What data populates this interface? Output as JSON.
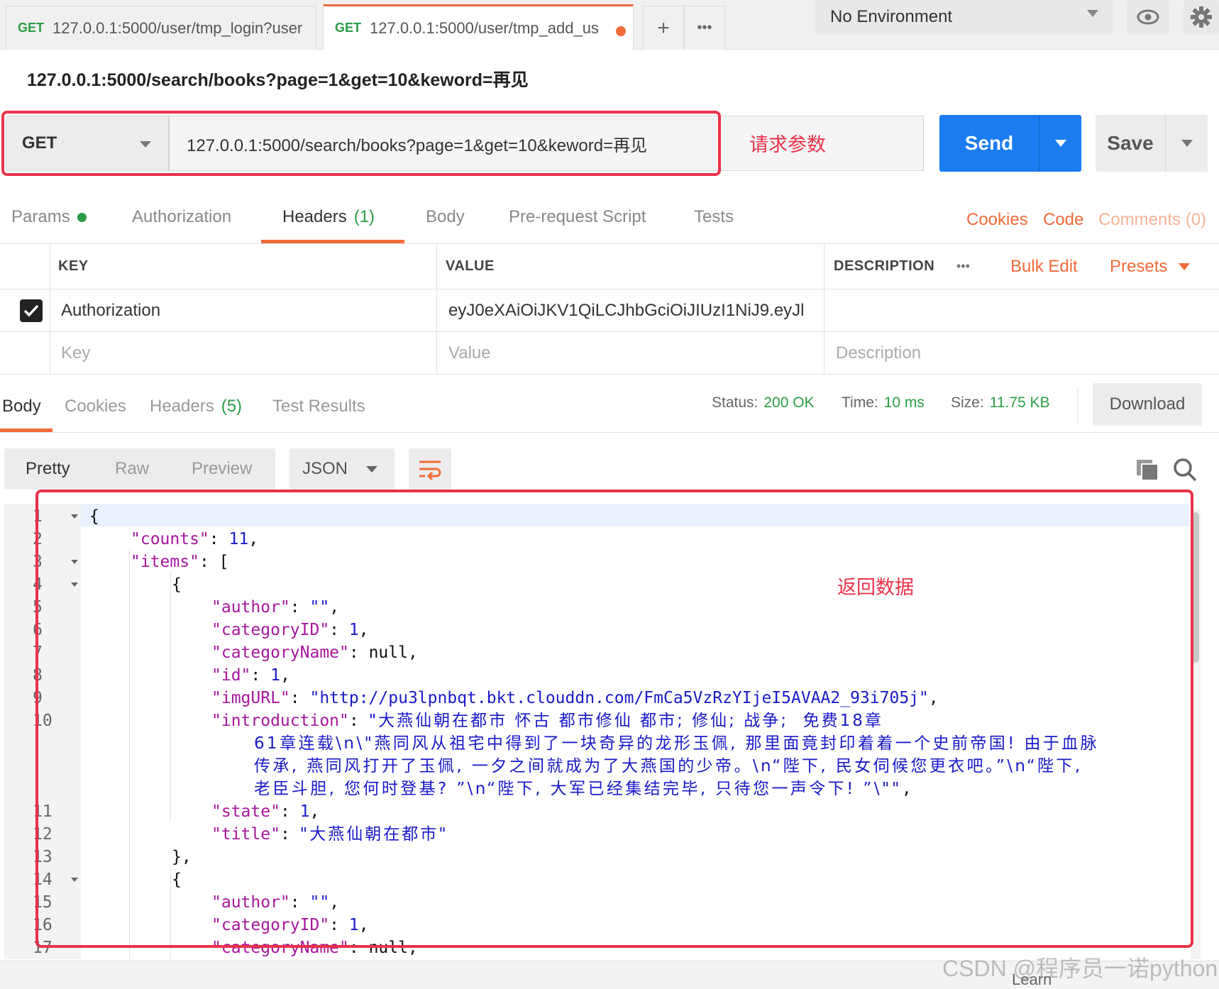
{
  "tabs": [
    {
      "method": "GET",
      "title": "127.0.0.1:5000/user/tmp_login?user"
    },
    {
      "method": "GET",
      "title": "127.0.0.1:5000/user/tmp_add_us"
    }
  ],
  "tab_controls": {
    "add": "+",
    "more": "•••"
  },
  "environment": {
    "selected": "No Environment"
  },
  "request": {
    "name": "127.0.0.1:5000/search/books?page=1&get=10&keword=再见",
    "method": "GET",
    "url": "127.0.0.1:5000/search/books?page=1&get=10&keword=再见",
    "send_label": "Send",
    "save_label": "Save"
  },
  "annotations": {
    "request_params": "请求参数",
    "response_data": "返回数据"
  },
  "request_tabs": {
    "params": "Params",
    "authorization": "Authorization",
    "headers": "Headers",
    "headers_count": "(1)",
    "body": "Body",
    "prerequest": "Pre-request Script",
    "tests": "Tests",
    "cookies": "Cookies",
    "code": "Code",
    "comments": "Comments (0)"
  },
  "headers_table": {
    "columns": {
      "key": "KEY",
      "value": "VALUE",
      "description": "DESCRIPTION"
    },
    "more": "•••",
    "bulk_edit": "Bulk Edit",
    "presets": "Presets",
    "rows": [
      {
        "enabled": true,
        "key": "Authorization",
        "value": "eyJ0eXAiOiJKV1QiLCJhbGciOiJIUzI1NiJ9.eyJle..."
      }
    ],
    "placeholder": {
      "key": "Key",
      "value": "Value",
      "description": "Description"
    }
  },
  "response": {
    "tabs": {
      "body": "Body",
      "cookies": "Cookies",
      "headers": "Headers",
      "headers_count": "(5)",
      "test_results": "Test Results"
    },
    "status_label": "Status:",
    "status": "200 OK",
    "time_label": "Time:",
    "time": "10 ms",
    "size_label": "Size:",
    "size": "11.75 KB",
    "download": "Download",
    "formats": {
      "pretty": "Pretty",
      "raw": "Raw",
      "preview": "Preview"
    },
    "language": "JSON"
  },
  "code": {
    "line_numbers": [
      "1",
      "2",
      "3",
      "4",
      "5",
      "6",
      "7",
      "8",
      "9",
      "10",
      "",
      "",
      "",
      "11",
      "12",
      "13",
      "14",
      "15",
      "16",
      "17"
    ],
    "lines": {
      "l1": "{",
      "l2_key": "\"counts\"",
      "l2_val": "11",
      "l3_key": "\"items\"",
      "l3_val": "[",
      "l4": "{",
      "l5_key": "\"author\"",
      "l5_val": "\"\"",
      "l6_key": "\"categoryID\"",
      "l6_val": "1",
      "l7_key": "\"categoryName\"",
      "l7_val": "null",
      "l8_key": "\"id\"",
      "l8_val": "1",
      "l9_key": "\"imgURL\"",
      "l9_val": "\"http://pu3lpnbqt.bkt.clouddn.com/FmCa5VzRzYIjeI5AVAA2_93i705j\"",
      "l10_key": "\"introduction\"",
      "l10_val_a": "\"大燕仙朝在都市 怀古 都市修仙 都市; 修仙; 战争;  免费18章",
      "l10_val_b": "61章连载\\n\\\"燕同风从祖宅中得到了一块奇异的龙形玉佩, 那里面竟封印着着一个史前帝国! 由于血脉",
      "l10_val_c": "传承, 燕同风打开了玉佩, 一夕之间就成为了大燕国的少帝。\\n“陛下, 民女伺候您更衣吧。”\\n“陛下,",
      "l10_val_d": "老臣斗胆, 您何时登基? ”\\n“陛下, 大军已经集结完毕, 只待您一声令下! ”\\\"\"",
      "l11_key": "\"state\"",
      "l11_val": "1",
      "l12_key": "\"title\"",
      "l12_val": "\"大燕仙朝在都市\"",
      "l13": "},",
      "l14": "{",
      "l15_key": "\"author\"",
      "l15_val": "\"\"",
      "l16_key": "\"categoryID\"",
      "l16_val": "1",
      "l17_key": "\"categoryName\"",
      "l17_val": "null"
    }
  },
  "footer": {
    "learn": "Learn"
  },
  "watermark": "CSDN @程序员一诺python",
  "colors": {
    "accent": "#f26b3a",
    "send": "#1a7cf0",
    "status_ok": "#2a9d44",
    "annotation": "#e8334a",
    "json_key": "#a7169e",
    "json_value": "#1a1ac8"
  }
}
